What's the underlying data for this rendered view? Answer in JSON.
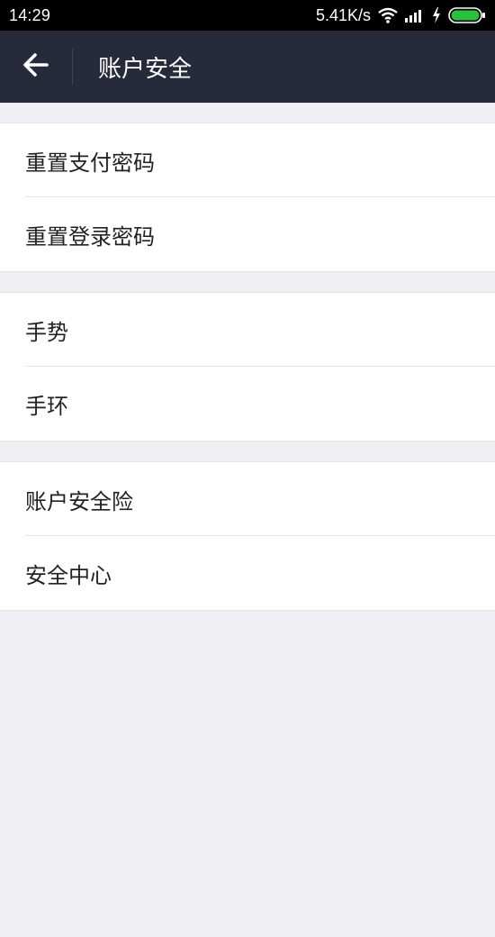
{
  "status_bar": {
    "time": "14:29",
    "network_speed": "5.41K/s",
    "icons": [
      "wifi-icon",
      "signal-icon",
      "charging-icon",
      "battery-icon"
    ]
  },
  "header": {
    "back_icon": "arrow-left-icon",
    "title": "账户安全"
  },
  "groups": [
    {
      "items": [
        {
          "label": "重置支付密码"
        },
        {
          "label": "重置登录密码"
        }
      ]
    },
    {
      "items": [
        {
          "label": "手势"
        },
        {
          "label": "手环"
        }
      ]
    },
    {
      "items": [
        {
          "label": "账户安全险"
        },
        {
          "label": "安全中心"
        }
      ]
    }
  ],
  "colors": {
    "header_bg": "#262a3a",
    "page_bg": "#efeff4",
    "battery_fill": "#27c13a"
  }
}
